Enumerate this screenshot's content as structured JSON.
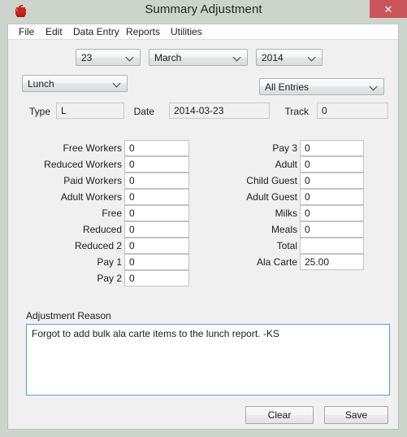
{
  "window": {
    "title": "Summary Adjustment",
    "app_icon": "apple-icon",
    "close_label": "✕",
    "frame_color": "#ccd4cc",
    "client_color": "#f0f0f0",
    "close_color": "#c9555b",
    "focus_border_color": "#5b9bd5"
  },
  "menubar": {
    "items": [
      {
        "label": "File"
      },
      {
        "label": "Edit"
      },
      {
        "label": "Data Entry"
      },
      {
        "label": "Reports"
      },
      {
        "label": "Utilities"
      }
    ]
  },
  "selectors": {
    "day": {
      "value": "23",
      "icon": "chevron-down-icon"
    },
    "month": {
      "value": "March",
      "icon": "chevron-down-icon"
    },
    "year": {
      "value": "2014",
      "icon": "chevron-down-icon"
    },
    "meal": {
      "value": "Lunch",
      "icon": "chevron-down-icon"
    },
    "entries": {
      "value": "All Entries",
      "icon": "chevron-down-icon"
    }
  },
  "info": {
    "type": {
      "label": "Type",
      "value": "L"
    },
    "date": {
      "label": "Date",
      "value": "2014-03-23"
    },
    "track": {
      "label": "Track",
      "value": "0"
    }
  },
  "counts": {
    "left": [
      {
        "label": "Free Workers",
        "value": "0"
      },
      {
        "label": "Reduced Workers",
        "value": "0"
      },
      {
        "label": "Paid Workers",
        "value": "0"
      },
      {
        "label": "Adult Workers",
        "value": "0"
      },
      {
        "label": "Free",
        "value": "0"
      },
      {
        "label": "Reduced",
        "value": "0"
      },
      {
        "label": "Reduced 2",
        "value": "0"
      },
      {
        "label": "Pay 1",
        "value": "0"
      },
      {
        "label": "Pay 2",
        "value": "0"
      }
    ],
    "right": [
      {
        "label": "Pay 3",
        "value": "0"
      },
      {
        "label": "Adult",
        "value": "0"
      },
      {
        "label": "Child Guest",
        "value": "0"
      },
      {
        "label": "Adult Guest",
        "value": "0"
      },
      {
        "label": "Milks",
        "value": "0"
      },
      {
        "label": "Meals",
        "value": "0"
      },
      {
        "label": "Total",
        "value": ""
      },
      {
        "label": "Ala Carte",
        "value": "25.00"
      }
    ]
  },
  "reason": {
    "label": "Adjustment Reason",
    "value": "Forgot to add bulk ala carte items to the lunch report. -KS",
    "placeholder": ""
  },
  "actions": {
    "clear_label": "Clear",
    "save_label": "Save"
  }
}
